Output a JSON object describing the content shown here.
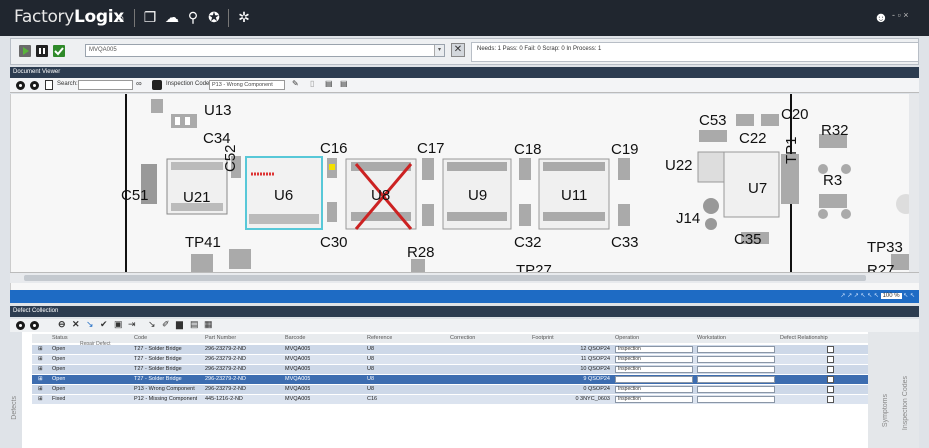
{
  "titlebar": {
    "brand": "Factory",
    "brand_bold": "Logix",
    "window_controls": "- ▫ ×"
  },
  "product": {
    "selected": "MVQA005"
  },
  "counts": {
    "text": "Needs: 1 Pass: 0 Fail: 0 Scrap: 0 In Process: 1"
  },
  "document_viewer": {
    "header": "Document Viewer",
    "search_label": "Search:",
    "search_value": "",
    "inspection_code_label": "Inspection Code:",
    "inspection_code_value": "P13 - Wrong Component",
    "labels": [
      "U13",
      "C34",
      "C16",
      "C17",
      "C18",
      "C19",
      "C52",
      "C51",
      "U21",
      "U6",
      "U8",
      "U9",
      "U11",
      "C30",
      "C32",
      "C33",
      "TP41",
      "R28",
      "TP27",
      "C53",
      "C22",
      "C20",
      "R32",
      "TP1",
      "U22",
      "U7",
      "R3",
      "J14",
      "C35",
      "TP33",
      "R27"
    ]
  },
  "zoom": "100 %",
  "defects": {
    "header": "Defect Collection",
    "tooltip": "Repair Defect",
    "columns": [
      "Status",
      "Code",
      "Part Number",
      "Barcode",
      "Reference",
      "Correction",
      "Footprint",
      "Operation",
      "Workstation",
      "Defect Relationship"
    ],
    "rows": [
      {
        "status": "Open",
        "code": "T27 - Solder Bridge",
        "part": "296-23279-2-ND",
        "barcode": "MVQA005",
        "ref": "U8",
        "correction": "",
        "footprint": "12 QSOP24",
        "operation": "Inspection",
        "workstation": "",
        "selected": false
      },
      {
        "status": "Open",
        "code": "T27 - Solder Bridge",
        "part": "296-23279-2-ND",
        "barcode": "MVQA005",
        "ref": "U8",
        "correction": "",
        "footprint": "11 QSOP24",
        "operation": "Inspection",
        "workstation": "",
        "selected": false
      },
      {
        "status": "Open",
        "code": "T27 - Solder Bridge",
        "part": "296-23279-2-ND",
        "barcode": "MVQA005",
        "ref": "U8",
        "correction": "",
        "footprint": "10 QSOP24",
        "operation": "Inspection",
        "workstation": "",
        "selected": false
      },
      {
        "status": "Open",
        "code": "T27 - Solder Bridge",
        "part": "296-23279-2-ND",
        "barcode": "MVQA005",
        "ref": "U8",
        "correction": "",
        "footprint": "9 QSOP24",
        "operation": "",
        "workstation": "",
        "selected": true
      },
      {
        "status": "Open",
        "code": "P13 - Wrong Component",
        "part": "296-23279-2-ND",
        "barcode": "MVQA005",
        "ref": "U8",
        "correction": "",
        "footprint": "0 QSOP24",
        "operation": "Inspection",
        "workstation": "",
        "selected": false
      },
      {
        "status": "Fixed",
        "code": "P12 - Missing Component",
        "part": "445-1216-2-ND",
        "barcode": "MVQA005",
        "ref": "C16",
        "correction": "",
        "footprint": "0 3NYC_0603",
        "operation": "Inspection",
        "workstation": "",
        "selected": false
      }
    ],
    "side_left": "Defects",
    "side_right1": "Symptoms",
    "side_right2": "Inspection Codes"
  }
}
